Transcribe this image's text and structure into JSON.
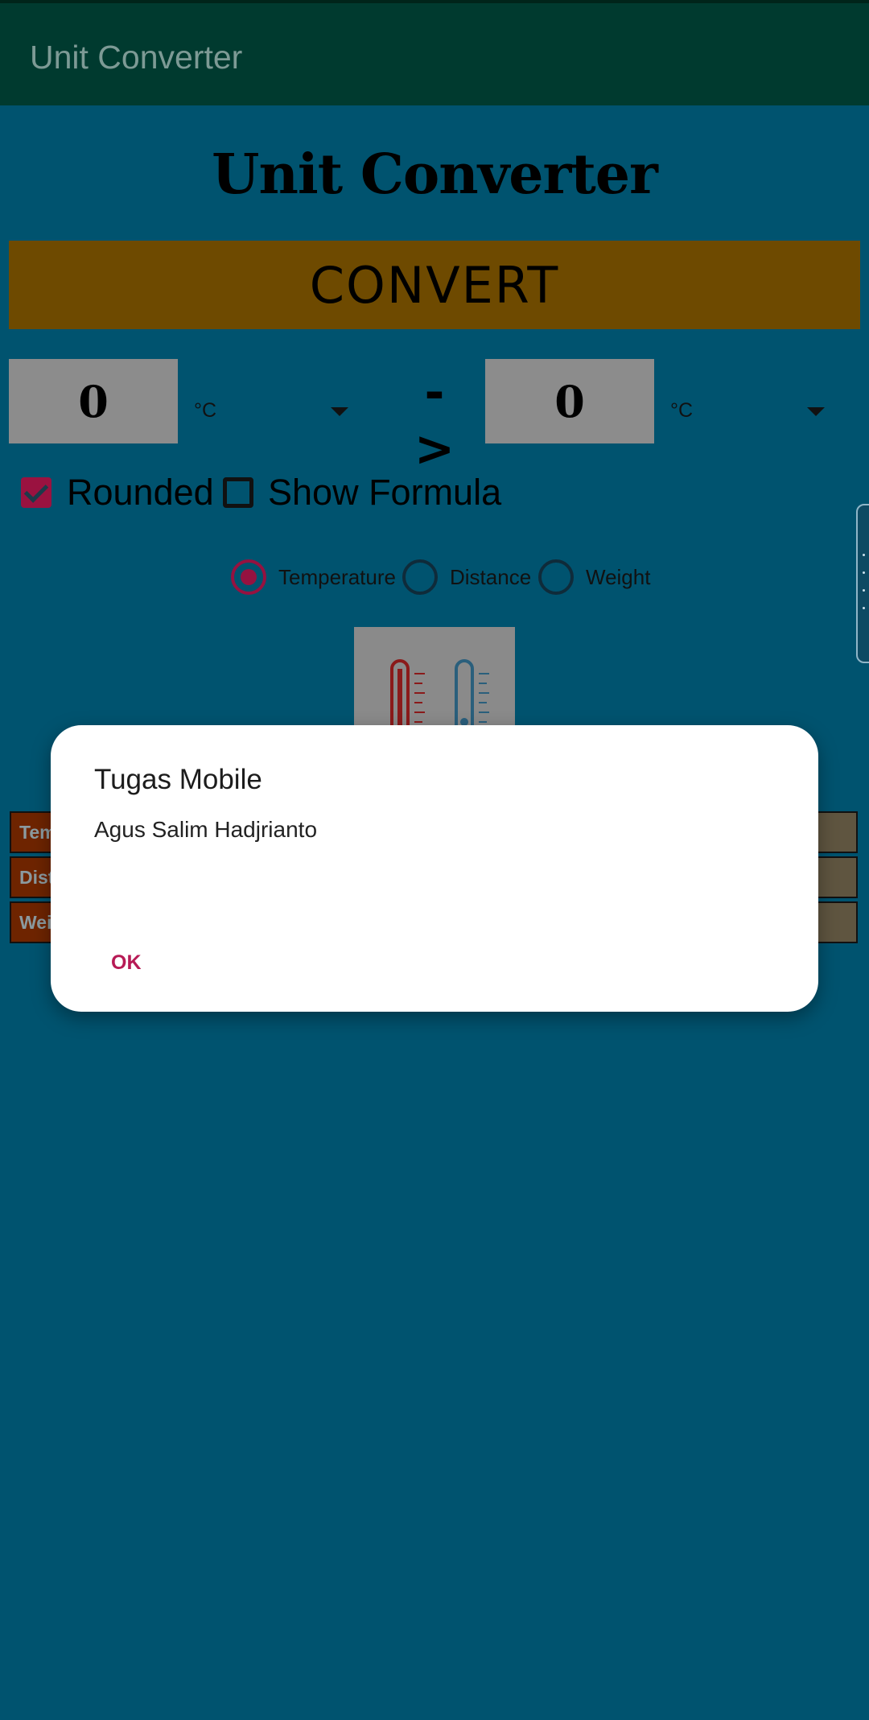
{
  "app_bar": {
    "title": "Unit Converter"
  },
  "main": {
    "title": "Unit Converter",
    "convert_label": "CONVERT",
    "input_value": "0",
    "input_unit": "°C",
    "arrow_text": "->",
    "output_value": "0",
    "output_unit": "°C"
  },
  "options": {
    "rounded_label": "Rounded",
    "rounded_checked": true,
    "show_formula_label": "Show Formula",
    "show_formula_checked": false
  },
  "categories": {
    "items": [
      {
        "label": "Temperature",
        "selected": true
      },
      {
        "label": "Distance",
        "selected": false
      },
      {
        "label": "Weight",
        "selected": false
      }
    ]
  },
  "table": {
    "rows": [
      "Tem",
      "Dist",
      "Wei"
    ]
  },
  "dialog": {
    "title": "Tugas Mobile",
    "message": "Agus Salim Hadjrianto",
    "ok_label": "OK"
  },
  "colors": {
    "app_bar": "#003a2f",
    "background": "#00536f",
    "convert_button": "#6e4a00",
    "accent": "#951240",
    "dialog_button": "#b71a55"
  },
  "icons": [
    "thermometer-hot-icon",
    "thermometer-cold-icon",
    "chevron-down-icon",
    "check-icon"
  ]
}
